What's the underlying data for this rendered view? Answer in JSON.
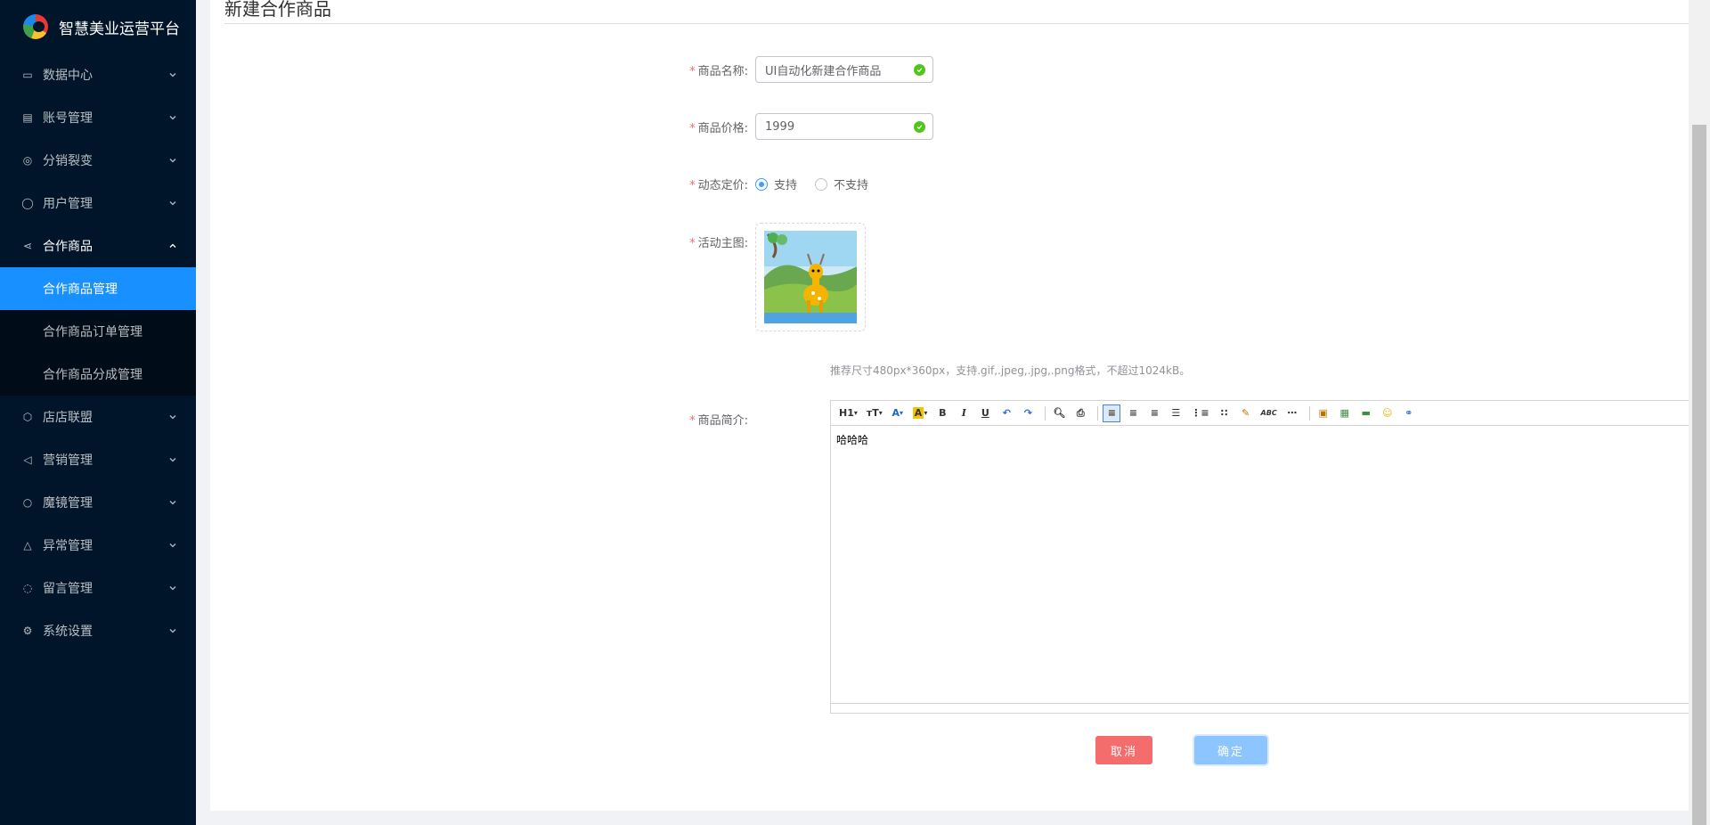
{
  "app": {
    "title": "智慧美业运营平台"
  },
  "sidebar": {
    "items": [
      {
        "label": "数据中心",
        "icon": "monitor-icon",
        "glyph": "▭"
      },
      {
        "label": "账号管理",
        "icon": "id-card-icon",
        "glyph": "▤"
      },
      {
        "label": "分销裂变",
        "icon": "share-circle-icon",
        "glyph": "◎"
      },
      {
        "label": "用户管理",
        "icon": "user-icon",
        "glyph": "◯"
      },
      {
        "label": "合作商品",
        "icon": "share-nodes-icon",
        "glyph": "⋖"
      },
      {
        "label": "店店联盟",
        "icon": "hexagon-icon",
        "glyph": "⬡"
      },
      {
        "label": "营销管理",
        "icon": "megaphone-icon",
        "glyph": "◁"
      },
      {
        "label": "魔镜管理",
        "icon": "bulb-icon",
        "glyph": "○"
      },
      {
        "label": "异常管理",
        "icon": "warning-icon",
        "glyph": "△"
      },
      {
        "label": "留言管理",
        "icon": "message-icon",
        "glyph": "◌"
      },
      {
        "label": "系统设置",
        "icon": "gear-icon",
        "glyph": "⚙"
      }
    ],
    "submenu": [
      {
        "label": "合作商品管理"
      },
      {
        "label": "合作商品订单管理"
      },
      {
        "label": "合作商品分成管理"
      }
    ]
  },
  "page": {
    "title": "新建合作商品"
  },
  "form": {
    "name_label": "商品名称:",
    "name_value": "UI自动化新建合作商品",
    "price_label": "商品价格:",
    "price_value": "1999",
    "dynamic_label": "动态定价:",
    "radio_yes": "支持",
    "radio_no": "不支持",
    "image_label": "活动主图:",
    "hint": "推荐尺寸480px*360px，支持.gif,.jpeg,.jpg,.png格式，不超过1024kB。",
    "intro_label": "商品简介:",
    "intro_content": "哈哈哈"
  },
  "toolbar": {
    "h1": "H1",
    "font_size": "тT",
    "font_color": "A",
    "highlight": "A",
    "bold": "B",
    "italic": "I",
    "underline": "U",
    "spell": "ABC"
  },
  "buttons": {
    "cancel": "取消",
    "ok": "确定"
  },
  "colors": {
    "sidebar_bg": "#001529",
    "active_menu": "#1890ff",
    "danger": "#f56c6c",
    "primary_light": "#8cc5ff",
    "success": "#52c41a"
  }
}
